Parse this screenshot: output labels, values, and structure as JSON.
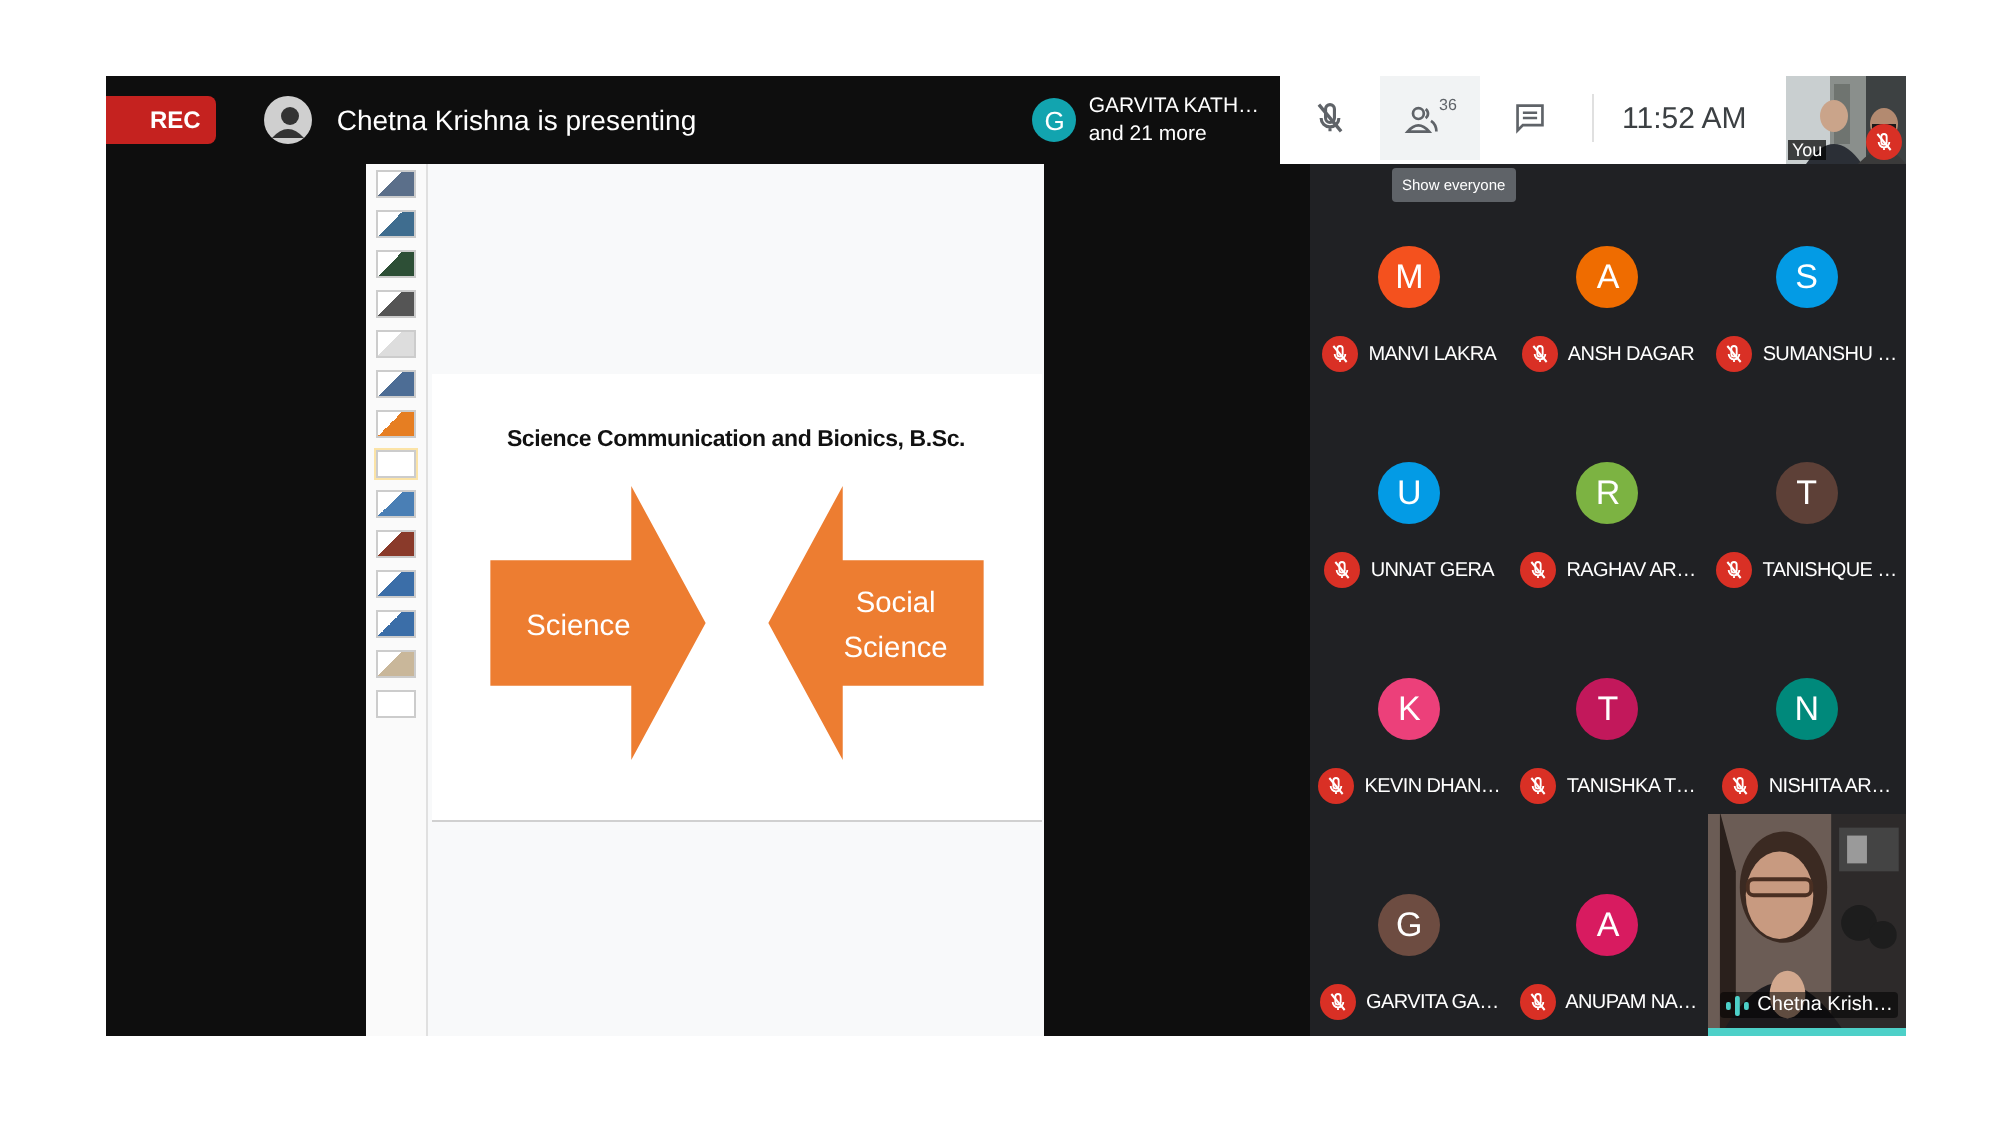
{
  "top_bar": {
    "recording_badge": "REC",
    "presenting_text": "Chetna Krishna is presenting"
  },
  "presenter_chip": {
    "initial": "G",
    "name": "GARVITA KATH…",
    "more": "and 21 more"
  },
  "controls": {
    "mic_muted": true,
    "people_count": "36",
    "time": "11:52 AM",
    "tooltip": "Show everyone"
  },
  "self_view": {
    "label": "You",
    "muted": true
  },
  "slides": {
    "thumbnails": [
      {
        "selected": false
      },
      {
        "selected": false
      },
      {
        "selected": false
      },
      {
        "selected": false
      },
      {
        "selected": false
      },
      {
        "selected": false
      },
      {
        "selected": false
      },
      {
        "selected": true
      },
      {
        "selected": false
      },
      {
        "selected": false
      },
      {
        "selected": false
      },
      {
        "selected": false
      },
      {
        "selected": false
      },
      {
        "selected": false
      }
    ],
    "slide_title": "Science Communication and Bionics, B.Sc.",
    "arrows": [
      {
        "kind": "right",
        "lines": [
          "Science"
        ]
      },
      {
        "kind": "left",
        "lines": [
          "Social",
          "Science"
        ]
      }
    ]
  },
  "participants": [
    {
      "initial": "M",
      "name": "MANVI LAKRA",
      "color": "#f4511e",
      "muted": true
    },
    {
      "initial": "A",
      "name": "ANSH DAGAR",
      "color": "#ef6c00",
      "muted": true
    },
    {
      "initial": "S",
      "name": "SUMANSHU …",
      "color": "#039be5",
      "muted": true
    },
    {
      "initial": "U",
      "name": "UNNAT GERA",
      "color": "#039be5",
      "muted": true
    },
    {
      "initial": "R",
      "name": "RAGHAV AR…",
      "color": "#7cb342",
      "muted": true
    },
    {
      "initial": "T",
      "name": "TANISHQUE …",
      "color": "#5d4037",
      "muted": true
    },
    {
      "initial": "K",
      "name": "KEVIN DHAN…",
      "color": "#ec407a",
      "muted": true
    },
    {
      "initial": "T",
      "name": "TANISHKA T…",
      "color": "#c2185b",
      "muted": true
    },
    {
      "initial": "N",
      "name": "NISHITA AR…",
      "color": "#00897b",
      "muted": true
    },
    {
      "initial": "G",
      "name": "GARVITA GA…",
      "color": "#6d4c41",
      "muted": true
    },
    {
      "initial": "A",
      "name": "ANUPAM NA…",
      "color": "#d81b60",
      "muted": true
    }
  ],
  "speaker_tile": {
    "name": "Chetna Krish…",
    "speaking": true
  }
}
